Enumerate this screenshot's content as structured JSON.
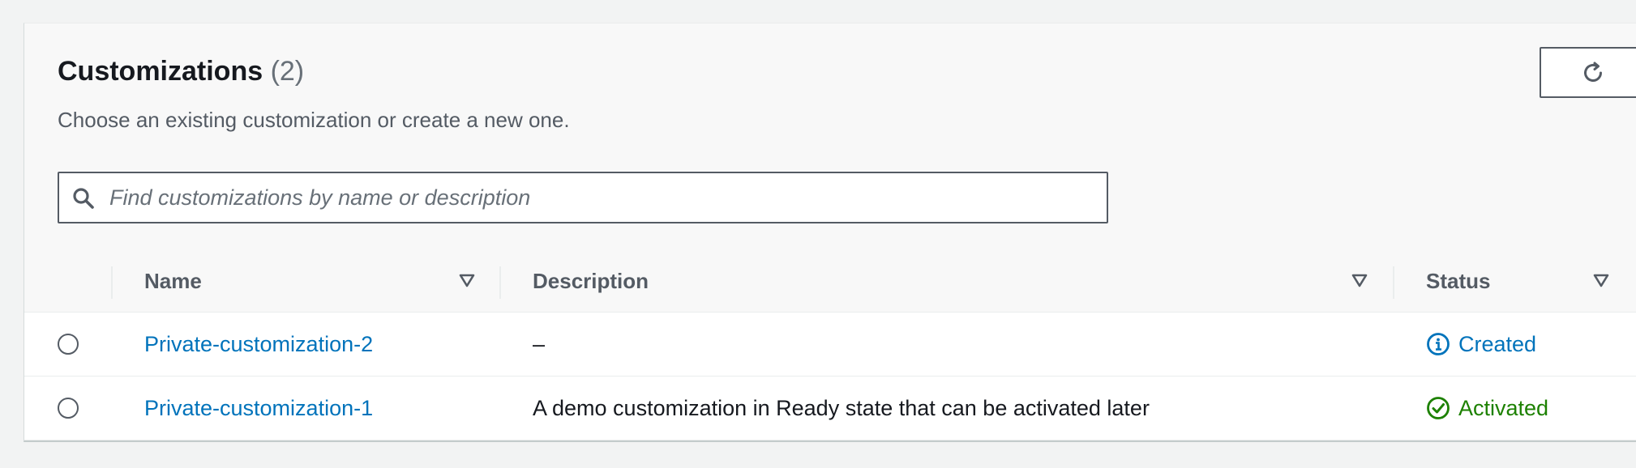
{
  "header": {
    "title": "Customizations",
    "count": "(2)",
    "subtitle": "Choose an existing customization or create a new one."
  },
  "search": {
    "placeholder": "Find customizations by name or description"
  },
  "table": {
    "columns": [
      "Name",
      "Description",
      "Status"
    ],
    "rows": [
      {
        "name": "Private-customization-2",
        "description": "–",
        "status": "Created",
        "status_type": "info"
      },
      {
        "name": "Private-customization-1",
        "description": "A demo customization in Ready state that can be activated later",
        "status": "Activated",
        "status_type": "success"
      }
    ]
  },
  "colors": {
    "link": "#0073bb",
    "success": "#1d8102",
    "border": "#545b64"
  },
  "icons": {
    "refresh": "refresh-icon",
    "search": "search-icon",
    "sort": "sort-caret-icon",
    "info": "info-circle-icon",
    "success": "check-circle-icon"
  }
}
